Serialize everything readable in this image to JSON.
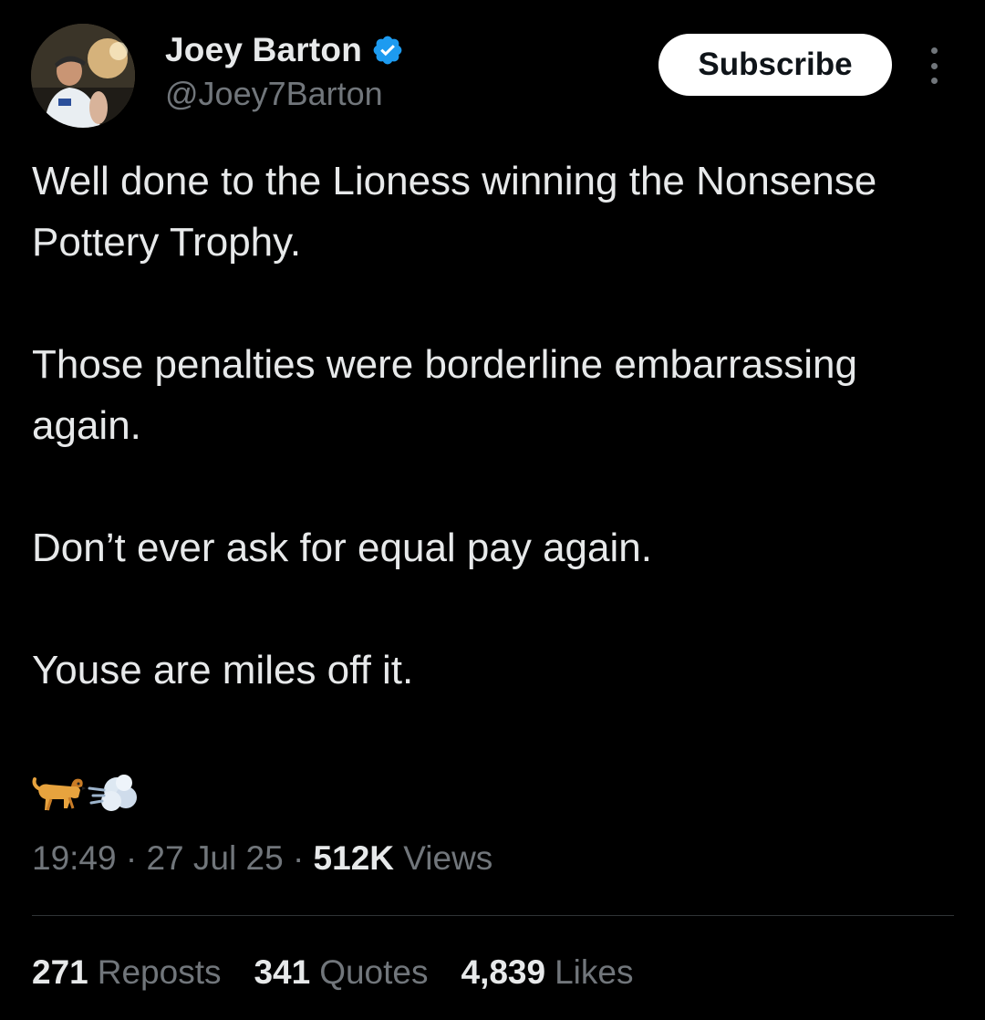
{
  "author": {
    "display_name": "Joey Barton",
    "handle": "@Joey7Barton",
    "verified": true,
    "verified_icon": "verified-badge-icon",
    "avatar_icon": "profile-photo"
  },
  "actions": {
    "subscribe_label": "Subscribe",
    "more_icon": "more-vertical-icon"
  },
  "tweet": {
    "paragraphs": [
      "Well done to the Lioness winning the Nonsense Pottery Trophy.",
      "Those penalties were borderline embarrassing again.",
      "Don’t ever ask for equal pay again.",
      "Youse are miles off it."
    ],
    "emojis": [
      "dog-emoji",
      "dash-emoji"
    ]
  },
  "meta": {
    "time": "19:49",
    "separator": "·",
    "date": "27 Jul 25",
    "views_count": "512K",
    "views_label": "Views"
  },
  "stats": {
    "reposts_count": "271",
    "reposts_label": "Reposts",
    "quotes_count": "341",
    "quotes_label": "Quotes",
    "likes_count": "4,839",
    "likes_label": "Likes"
  },
  "colors": {
    "background": "#000000",
    "primary_text": "#e7e9ea",
    "secondary_text": "#71767b",
    "verified_blue": "#1d9bf0",
    "divider": "#2f3336"
  }
}
